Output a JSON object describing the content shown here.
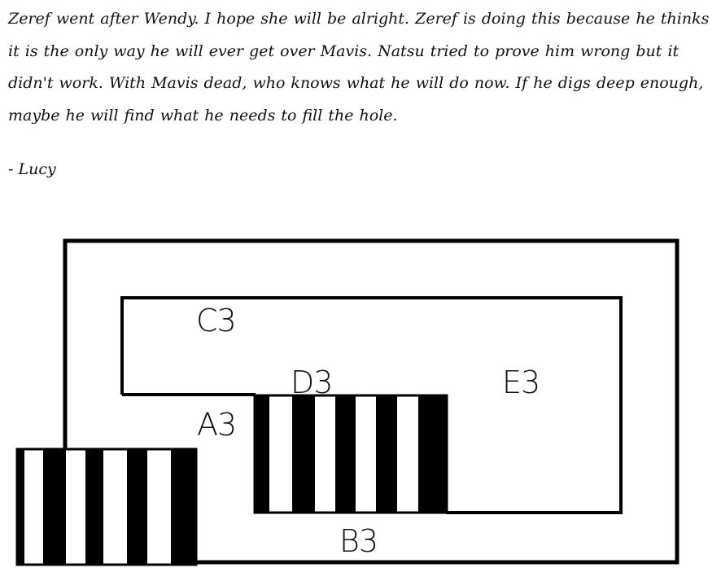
{
  "note": {
    "paragraph": "Zeref went after Wendy. I hope she will be alright. Zeref is doing this because he thinks it is the only way he will ever get over Mavis. Natsu tried to prove him wrong but it didn't work. With Mavis dead, who knows what he will do now. If he digs deep enough, maybe he will find what he needs to fill the hole.",
    "signature": "- Lucy"
  },
  "map": {
    "labels": {
      "a3": "A3",
      "b3": "B3",
      "c3": "C3",
      "d3": "D3",
      "e3": "E3"
    },
    "colors": {
      "ink": "#000000",
      "background": "#ffffff"
    }
  }
}
